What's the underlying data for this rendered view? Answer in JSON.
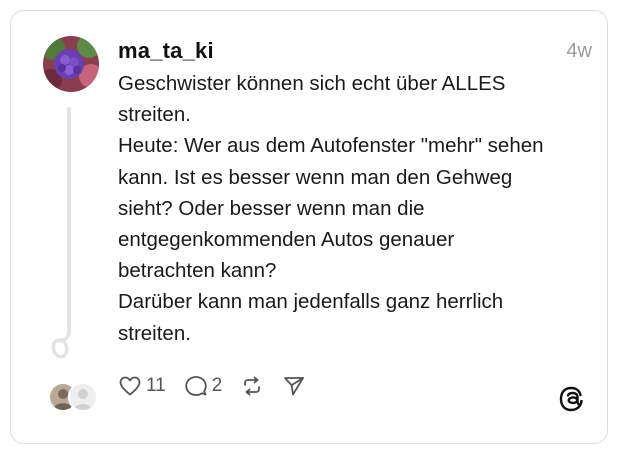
{
  "post": {
    "username": "ma_ta_ki",
    "timestamp": "4w",
    "lines": [
      "Geschwister können sich echt über ALLES",
      "streiten.",
      "Heute: Wer aus dem Autofenster \"mehr\" sehen",
      "kann. Ist es besser wenn man den Gehweg",
      "sieht? Oder besser wenn man die",
      "entgegenkommenden Autos genauer",
      "betrachten kann?",
      "Darüber kann man jedenfalls ganz herrlich",
      "streiten."
    ]
  },
  "actions": {
    "like_count": "11",
    "reply_count": "2"
  },
  "icons": {
    "like": "heart-icon",
    "reply": "comment-bubble-icon",
    "repost": "repost-icon",
    "share": "send-icon",
    "brand": "threads-logo-icon"
  },
  "colors": {
    "border": "#dcdcdc",
    "icon": "#555555",
    "timestamp": "#9a9a9a"
  }
}
